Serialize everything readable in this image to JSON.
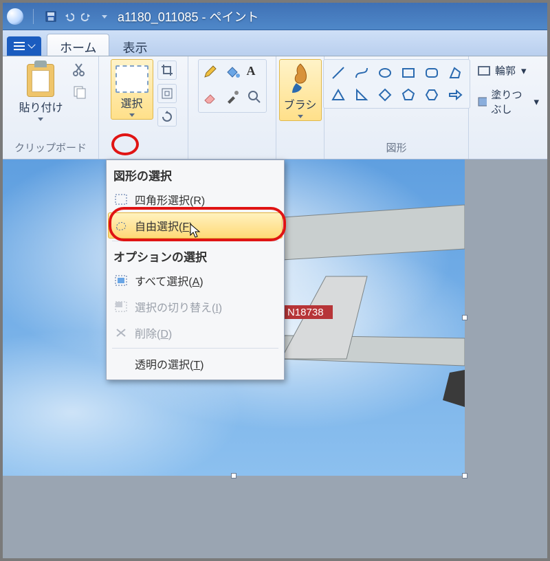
{
  "title": "a1180_011085 - ペイント",
  "tabs": {
    "home": "ホーム",
    "view": "表示"
  },
  "groups": {
    "clipboard": {
      "label": "クリップボード",
      "paste": "貼り付け"
    },
    "image_select": "選択",
    "brushes": "ブラシ",
    "shapes": "図形",
    "outline": "輪郭",
    "fill": "塗りつぶし"
  },
  "dropdown": {
    "heading_shapes": "図形の選択",
    "rect_select": "四角形選択(R)",
    "free_select_prefix": "自由選択(",
    "free_select_accel": "F",
    "free_select_suffix": ")",
    "heading_options": "オプションの選択",
    "select_all_prefix": "すべて選択(",
    "select_all_accel": "A",
    "select_all_suffix": ")",
    "invert_prefix": "選択の切り替え(",
    "invert_accel": "I",
    "invert_suffix": ")",
    "delete_prefix": "削除(",
    "delete_accel": "D",
    "delete_suffix": ")",
    "transparent_prefix": "透明の選択(",
    "transparent_accel": "T",
    "transparent_suffix": ")"
  },
  "plane_reg": "N18738"
}
